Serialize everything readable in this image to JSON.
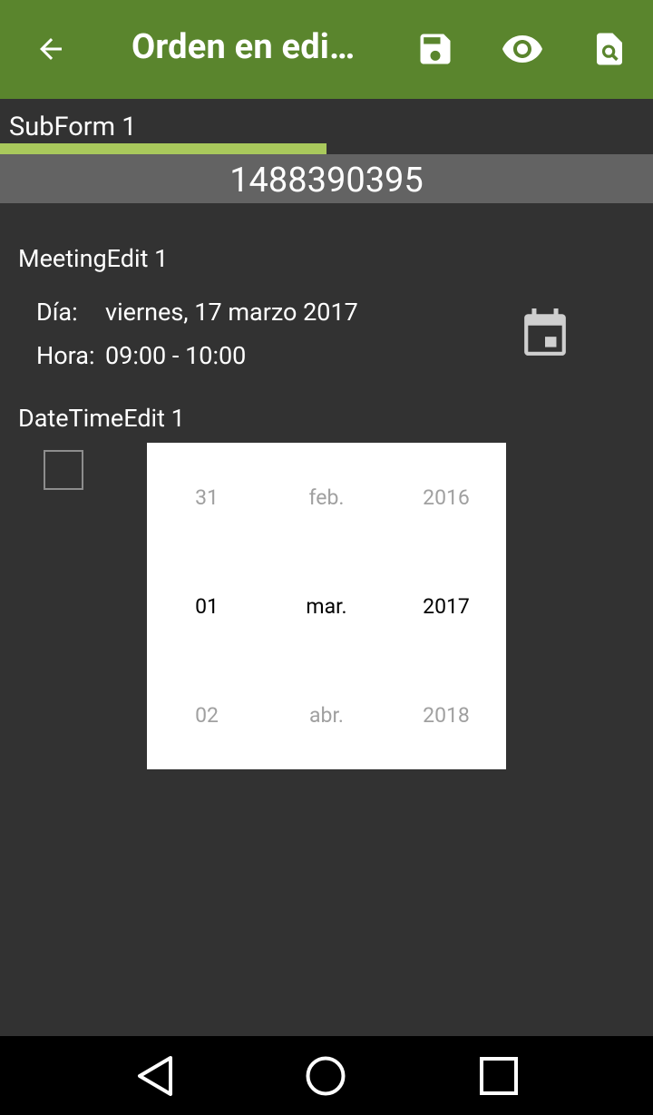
{
  "appbar": {
    "title": "Orden en edi…",
    "back_icon": "arrow-back-icon",
    "save_icon": "save-icon",
    "preview_icon": "eye-icon",
    "search_icon": "document-search-icon",
    "color": "#5a852d"
  },
  "tab": {
    "label": "SubForm 1",
    "indicator_color": "#a9c95c"
  },
  "record_number": "1488390395",
  "meeting": {
    "section_label": "MeetingEdit 1",
    "day_label": "Día:",
    "day_value": "viernes, 17 marzo 2017",
    "time_label": "Hora:",
    "time_value": "09:00 - 10:00",
    "calendar_icon": "calendar-icon"
  },
  "datetime": {
    "section_label": "DateTimeEdit 1",
    "checkbox_checked": false,
    "picker": {
      "day": {
        "prev": "31",
        "selected": "01",
        "next": "02"
      },
      "month": {
        "prev": "feb.",
        "selected": "mar.",
        "next": "abr."
      },
      "year": {
        "prev": "2016",
        "selected": "2017",
        "next": "2018"
      }
    }
  },
  "navbar": {
    "back_icon": "nav-back-icon",
    "home_icon": "nav-home-icon",
    "recents_icon": "nav-recents-icon"
  }
}
